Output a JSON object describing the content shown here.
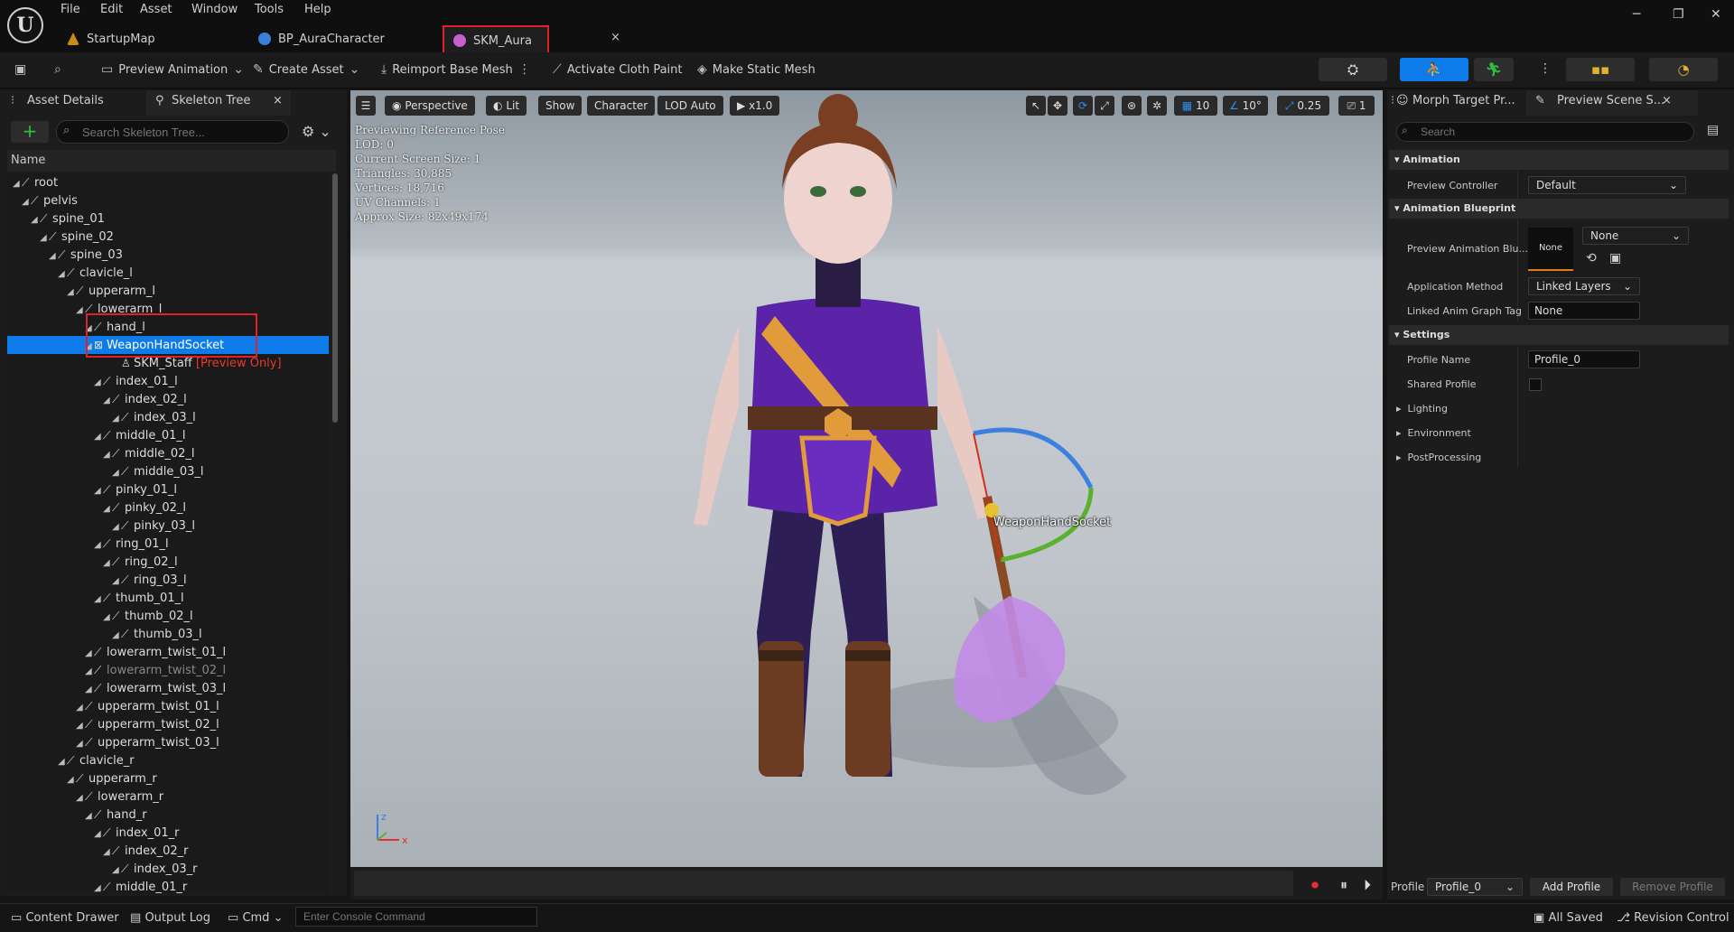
{
  "menu": [
    "File",
    "Edit",
    "Asset",
    "Window",
    "Tools",
    "Help"
  ],
  "tabs": [
    {
      "label": "StartupMap"
    },
    {
      "label": "BP_AuraCharacter"
    },
    {
      "label": "SKM_Aura",
      "close": "×"
    }
  ],
  "window_controls": {
    "minimize": "─",
    "restore": "❐",
    "close": "✕"
  },
  "toolbar": {
    "preview_animation": "Preview Animation",
    "create_asset": "Create Asset",
    "reimport": "Reimport Base Mesh",
    "cloth": "Activate Cloth Paint",
    "static_mesh": "Make Static Mesh"
  },
  "left_panel": {
    "tab_details": "Asset Details",
    "tab_skeleton": "Skeleton Tree",
    "tab_close": "×",
    "add": "+",
    "search_placeholder": "Search Skeleton Tree...",
    "name_header": "Name",
    "tree": [
      {
        "label": "root",
        "depth": 0
      },
      {
        "label": "pelvis",
        "depth": 1
      },
      {
        "label": "spine_01",
        "depth": 2
      },
      {
        "label": "spine_02",
        "depth": 3
      },
      {
        "label": "spine_03",
        "depth": 4
      },
      {
        "label": "clavicle_l",
        "depth": 5
      },
      {
        "label": "upperarm_l",
        "depth": 6
      },
      {
        "label": "lowerarm_l",
        "depth": 7
      },
      {
        "label": "hand_l",
        "depth": 8
      },
      {
        "label": "WeaponHandSocket",
        "depth": 8,
        "kind": "socket",
        "selected": true
      },
      {
        "label": "SKM_Staff",
        "depth": 11,
        "kind": "mesh",
        "suffix": "[Preview Only]"
      },
      {
        "label": "index_01_l",
        "depth": 9
      },
      {
        "label": "index_02_l",
        "depth": 10
      },
      {
        "label": "index_03_l",
        "depth": 11
      },
      {
        "label": "middle_01_l",
        "depth": 9
      },
      {
        "label": "middle_02_l",
        "depth": 10
      },
      {
        "label": "middle_03_l",
        "depth": 11
      },
      {
        "label": "pinky_01_l",
        "depth": 9
      },
      {
        "label": "pinky_02_l",
        "depth": 10
      },
      {
        "label": "pinky_03_l",
        "depth": 11
      },
      {
        "label": "ring_01_l",
        "depth": 9
      },
      {
        "label": "ring_02_l",
        "depth": 10
      },
      {
        "label": "ring_03_l",
        "depth": 11
      },
      {
        "label": "thumb_01_l",
        "depth": 9
      },
      {
        "label": "thumb_02_l",
        "depth": 10
      },
      {
        "label": "thumb_03_l",
        "depth": 11
      },
      {
        "label": "lowerarm_twist_01_l",
        "depth": 8
      },
      {
        "label": "lowerarm_twist_02_l",
        "depth": 8,
        "dim": true
      },
      {
        "label": "lowerarm_twist_03_l",
        "depth": 8
      },
      {
        "label": "upperarm_twist_01_l",
        "depth": 7
      },
      {
        "label": "upperarm_twist_02_l",
        "depth": 7
      },
      {
        "label": "upperarm_twist_03_l",
        "depth": 7
      },
      {
        "label": "clavicle_r",
        "depth": 5
      },
      {
        "label": "upperarm_r",
        "depth": 6
      },
      {
        "label": "lowerarm_r",
        "depth": 7
      },
      {
        "label": "hand_r",
        "depth": 8
      },
      {
        "label": "index_01_r",
        "depth": 9
      },
      {
        "label": "index_02_r",
        "depth": 10
      },
      {
        "label": "index_03_r",
        "depth": 11
      },
      {
        "label": "middle_01_r",
        "depth": 9
      }
    ]
  },
  "viewport": {
    "perspective": "Perspective",
    "lit": "Lit",
    "show": "Show",
    "character": "Character",
    "lod": "LOD Auto",
    "speed": "x1.0",
    "grid_value": "10",
    "angle_value": "10°",
    "scale_value": "0.25",
    "camera_value": "1",
    "info": [
      "Previewing Reference Pose",
      "LOD: 0",
      "Current Screen Size: 1",
      "Triangles: 30,885",
      "Vertices: 18,716",
      "UV Channels: 1",
      "Approx Size: 82x49x174"
    ],
    "socket_label": "WeaponHandSocket",
    "axis_z": "z",
    "axis_x": "x"
  },
  "right_panel": {
    "tab_morph": "Morph Target Pr...",
    "tab_preview": "Preview Scene S...",
    "tab_close": "×",
    "search_placeholder": "Search",
    "animation_header": "Animation",
    "preview_controller_label": "Preview Controller",
    "preview_controller_value": "Default",
    "anim_bp_header": "Animation Blueprint",
    "preview_anim_bp_label": "Preview Animation Blu...",
    "anim_bp_thumb": "None",
    "anim_bp_value": "None",
    "application_method_label": "Application Method",
    "application_method_value": "Linked Layers",
    "linked_tag_label": "Linked Anim Graph Tag",
    "linked_tag_value": "None",
    "settings_header": "Settings",
    "profile_name_label": "Profile Name",
    "profile_name_value": "Profile_0",
    "shared_profile_label": "Shared Profile",
    "lighting": "Lighting",
    "environment": "Environment",
    "postprocessing": "PostProcessing",
    "profile_label": "Profile",
    "profile_select": "Profile_0",
    "add_profile": "Add Profile",
    "remove_profile": "Remove Profile"
  },
  "statusbar": {
    "content_drawer": "Content Drawer",
    "output_log": "Output Log",
    "cmd": "Cmd",
    "console_placeholder": "Enter Console Command",
    "all_saved": "All Saved",
    "revision_control": "Revision Control"
  },
  "colors": {
    "accent": "#0e7bea",
    "highlight": "#e0202a",
    "preview_only": "#e8392c"
  }
}
